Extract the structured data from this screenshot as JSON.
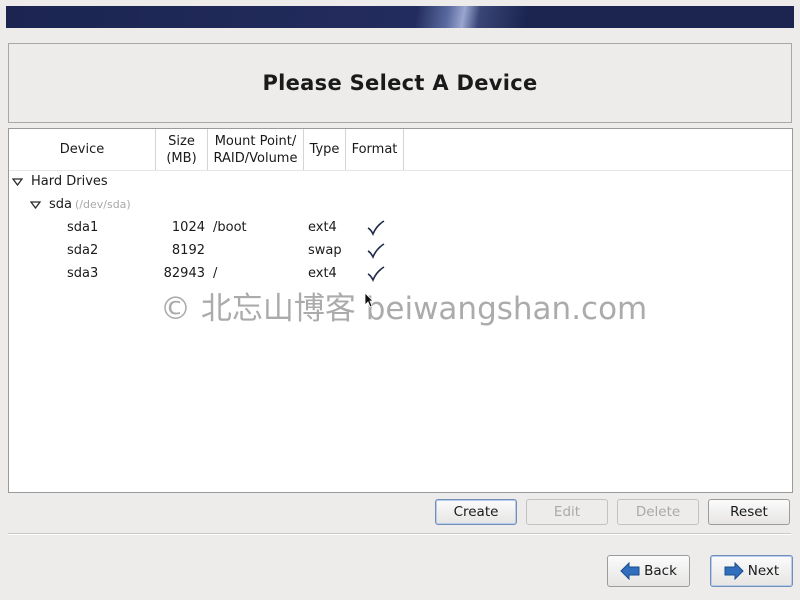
{
  "header": {
    "title": "Please Select A Device"
  },
  "columns": [
    {
      "label": "Device"
    },
    {
      "label": "Size\n(MB)"
    },
    {
      "label": "Mount Point/\nRAID/Volume"
    },
    {
      "label": "Type"
    },
    {
      "label": "Format"
    }
  ],
  "tree": {
    "group_label": "Hard Drives",
    "disk": {
      "name": "sda",
      "path": "(/dev/sda)"
    },
    "partitions": [
      {
        "device": "sda1",
        "size": "1024",
        "mount": "/boot",
        "type": "ext4",
        "format": true
      },
      {
        "device": "sda2",
        "size": "8192",
        "mount": "",
        "type": "swap",
        "format": true
      },
      {
        "device": "sda3",
        "size": "82943",
        "mount": "/",
        "type": "ext4",
        "format": true
      }
    ]
  },
  "watermark": "© 北忘山博客 beiwangshan.com",
  "actions": {
    "create": "Create",
    "edit": "Edit",
    "delete": "Delete",
    "reset": "Reset"
  },
  "nav": {
    "back": "Back",
    "next": "Next"
  },
  "colors": {
    "banner": "#1b2550",
    "focus_border": "#6f8fbc",
    "arrow_blue": "#2f6fbd"
  }
}
